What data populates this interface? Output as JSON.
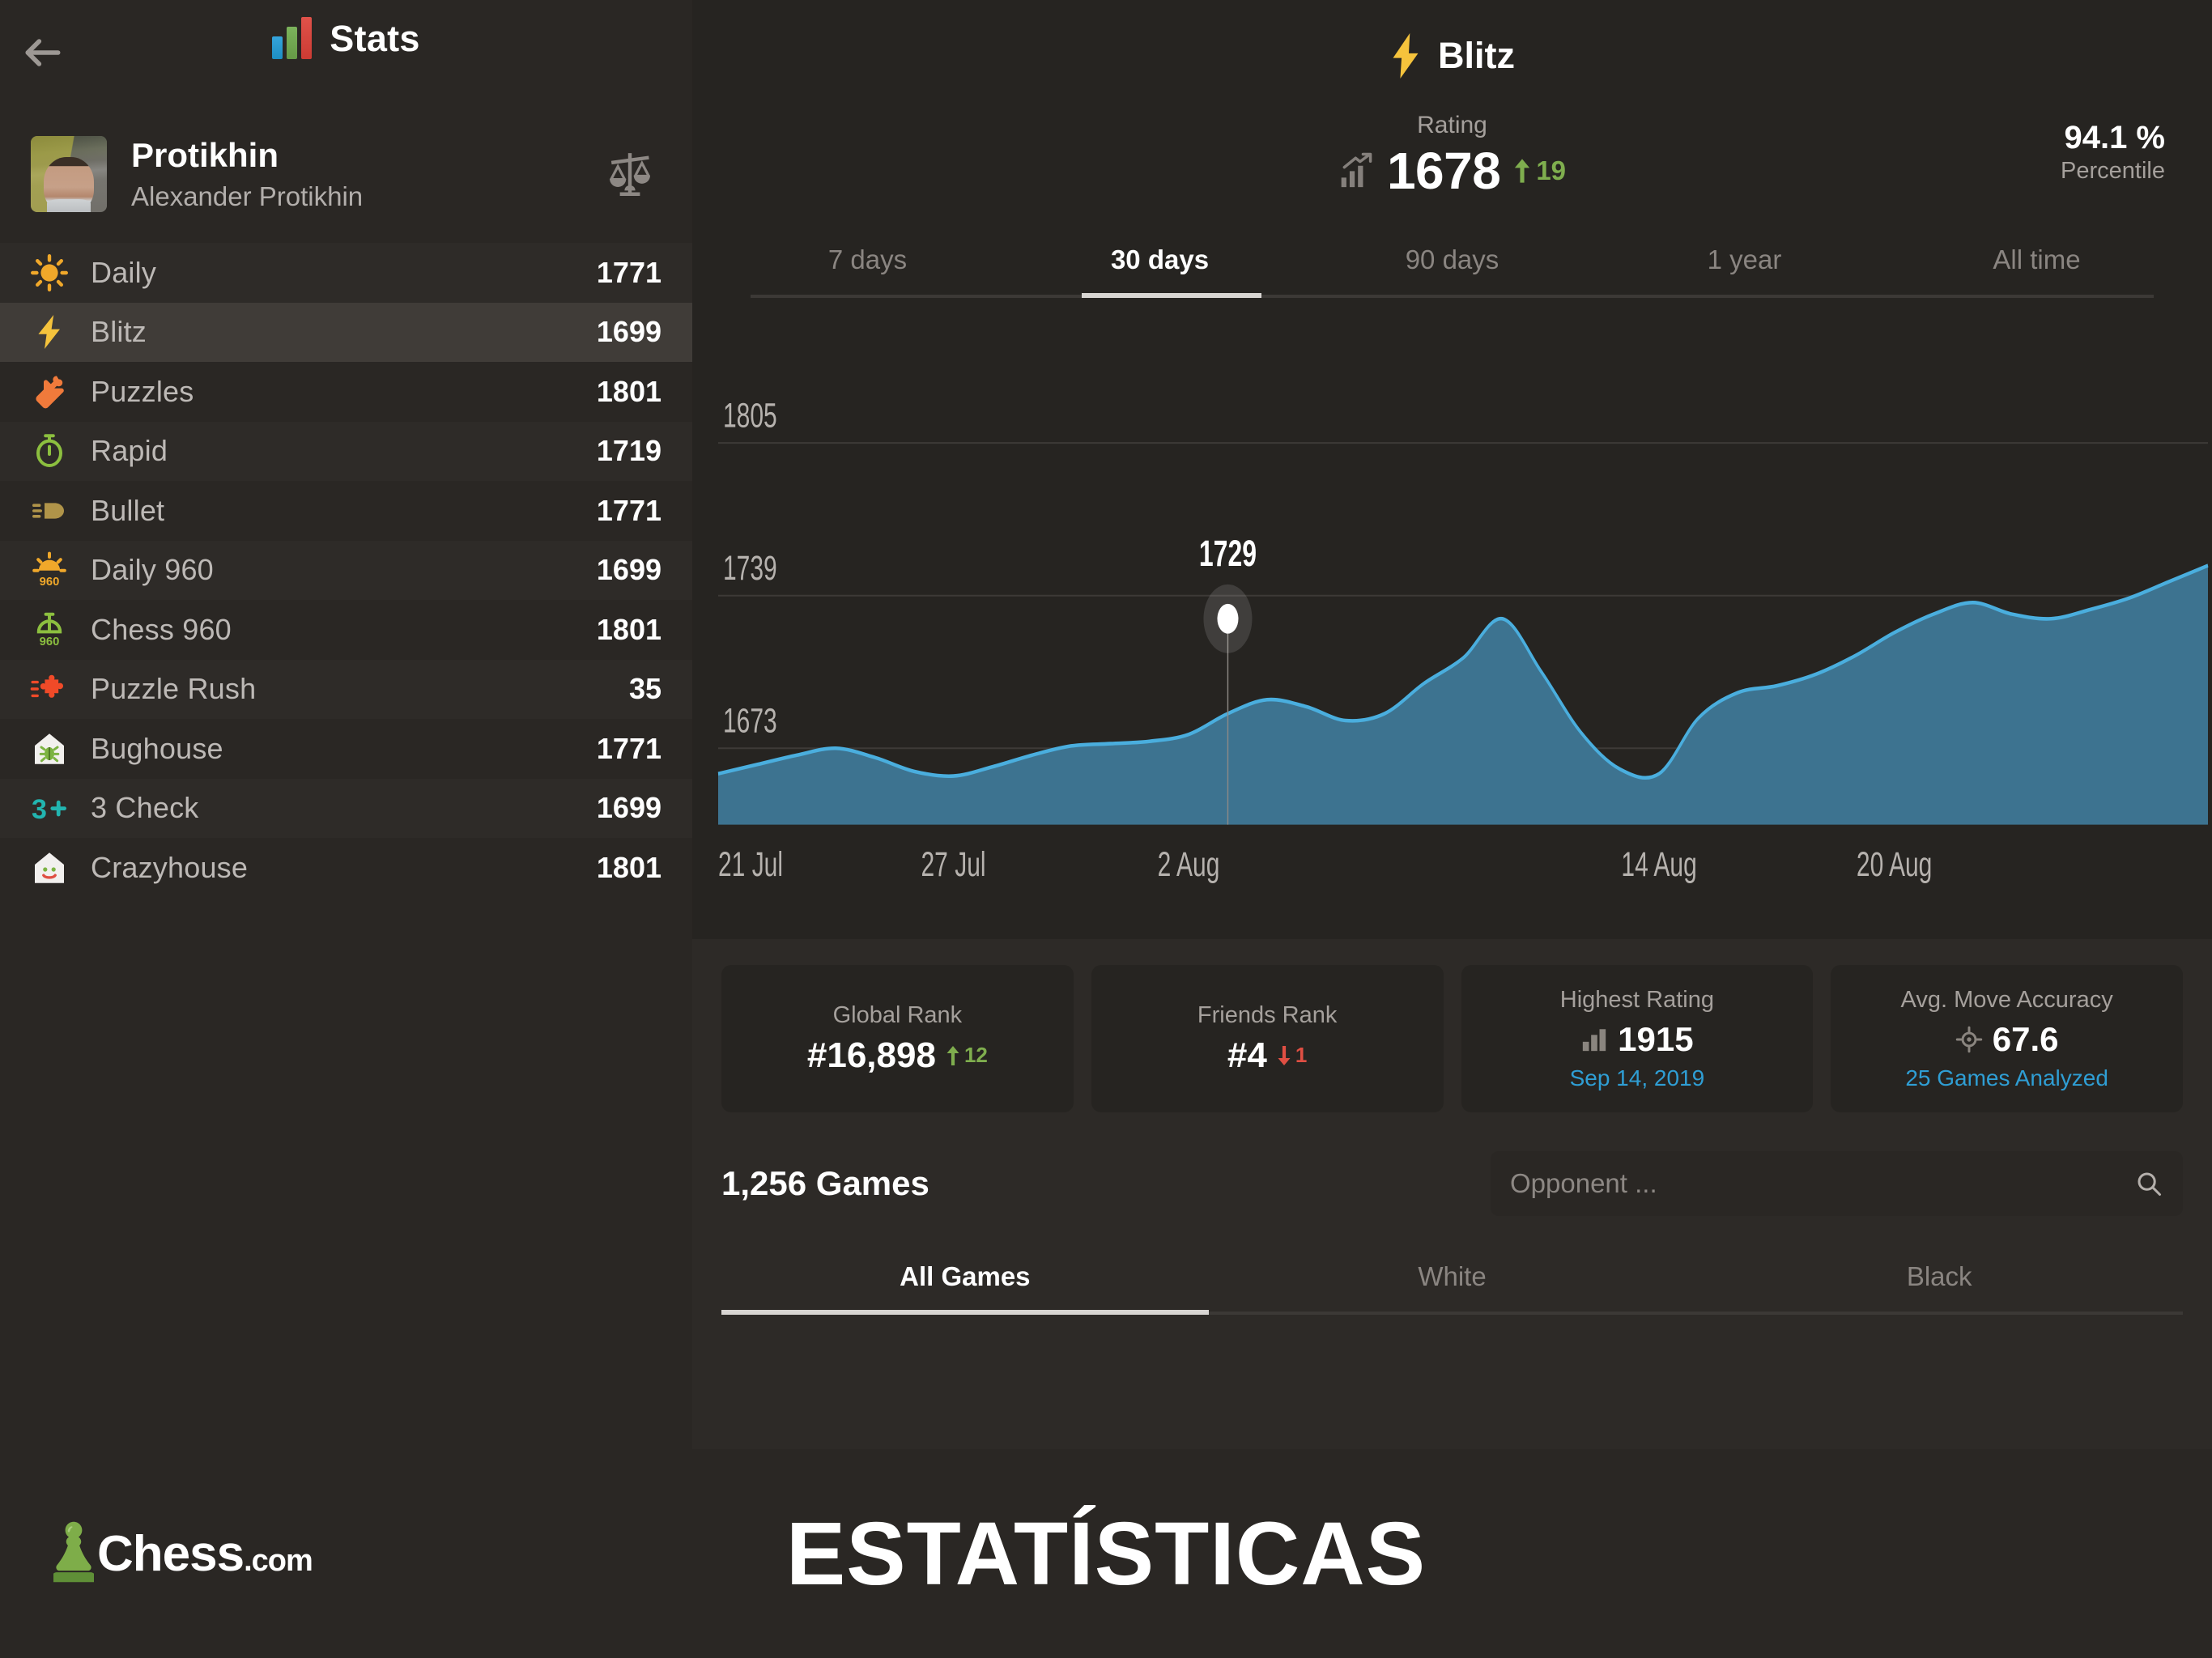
{
  "sidebar": {
    "back_icon": "back-arrow-icon",
    "title": "Stats",
    "profile": {
      "username": "Protikhin",
      "real_name": "Alexander Protikhin",
      "flag": "ukraine-flag",
      "compare_icon": "balance-scales-icon"
    },
    "items": [
      {
        "label": "Daily",
        "value": "1771",
        "icon": "sun-icon"
      },
      {
        "label": "Blitz",
        "value": "1699",
        "icon": "lightning-bolt-icon"
      },
      {
        "label": "Puzzles",
        "value": "1801",
        "icon": "puzzle-piece-icon"
      },
      {
        "label": "Rapid",
        "value": "1719",
        "icon": "stopwatch-icon"
      },
      {
        "label": "Bullet",
        "value": "1771",
        "icon": "bullet-icon"
      },
      {
        "label": "Daily 960",
        "value": "1699",
        "icon": "sun-960-icon"
      },
      {
        "label": "Chess 960",
        "value": "1801",
        "icon": "stopwatch-960-icon"
      },
      {
        "label": "Puzzle Rush",
        "value": "35",
        "icon": "puzzle-rush-icon"
      },
      {
        "label": "Bughouse",
        "value": "1771",
        "icon": "bughouse-icon"
      },
      {
        "label": "3 Check",
        "value": "1699",
        "icon": "three-check-icon"
      },
      {
        "label": "Crazyhouse",
        "value": "1801",
        "icon": "crazyhouse-icon"
      }
    ],
    "active_index": 1
  },
  "main": {
    "header": {
      "title": "Blitz",
      "icon": "lightning-bolt-icon"
    },
    "rating": {
      "label": "Rating",
      "value": "1678",
      "delta": "19",
      "delta_direction": "up",
      "icon": "rating-chart-icon"
    },
    "percentile": {
      "value": "94.1 %",
      "label": "Percentile"
    },
    "range_tabs": [
      {
        "label": "7 days"
      },
      {
        "label": "30 days"
      },
      {
        "label": "90 days"
      },
      {
        "label": "1 year"
      },
      {
        "label": "All time"
      }
    ],
    "range_active_index": 1,
    "cards": [
      {
        "title": "Global Rank",
        "value": "#16,898",
        "change": "12",
        "change_direction": "up",
        "sub": "",
        "icon": ""
      },
      {
        "title": "Friends Rank",
        "value": "#4",
        "change": "1",
        "change_direction": "down",
        "sub": "",
        "icon": ""
      },
      {
        "title": "Highest Rating",
        "value": "1915",
        "change": "",
        "change_direction": "",
        "sub": "Sep 14, 2019",
        "icon": "bar-chart-icon"
      },
      {
        "title": "Avg. Move Accuracy",
        "value": "67.6",
        "change": "",
        "change_direction": "",
        "sub": "25 Games Analyzed",
        "icon": "target-icon"
      }
    ],
    "games": {
      "count_label": "1,256 Games",
      "search_placeholder": "Opponent ...",
      "search_value": "",
      "search_icon": "search-icon",
      "tabs": [
        {
          "label": "All Games"
        },
        {
          "label": "White"
        },
        {
          "label": "Black"
        }
      ],
      "tabs_active_index": 0
    }
  },
  "footer": {
    "brand": "Chess",
    "brand_suffix": ".com",
    "title": "ESTATÍSTICAS",
    "logo_icon": "chess-pawn-logo"
  },
  "colors": {
    "accent_blue": "#4aaede",
    "area_fill": "#3d7390",
    "positive": "#7fae4e",
    "negative": "#e04f43",
    "link": "#2f9ed4",
    "bg": "#262421",
    "panel": "#2a2724",
    "lower_panel": "#2d2a27"
  },
  "chart_data": {
    "type": "area",
    "title": "",
    "xlabel": "",
    "ylabel": "Rating",
    "ylim": [
      1640,
      1838
    ],
    "grid": true,
    "ytick_labels": [
      "1805",
      "1739",
      "1673"
    ],
    "ytick_values": [
      1805,
      1739,
      1673
    ],
    "xtick_labels": [
      "21 Jul",
      "27 Jul",
      "2 Aug",
      "14 Aug",
      "20 Aug"
    ],
    "xtick_positions": [
      0,
      6,
      12,
      24,
      30
    ],
    "highlight": {
      "label": "1729",
      "value": 1729,
      "x_index": 13
    },
    "x": [
      0,
      1,
      2,
      3,
      4,
      5,
      6,
      7,
      8,
      9,
      10,
      11,
      12,
      13,
      14,
      15,
      16,
      17,
      18,
      19,
      20,
      21,
      22,
      23,
      24,
      25,
      26,
      27,
      28,
      29,
      30,
      31,
      32,
      33,
      34,
      35
    ],
    "values": [
      1662,
      1666,
      1670,
      1673,
      1669,
      1663,
      1661,
      1665,
      1670,
      1674,
      1675,
      1676,
      1679,
      1688,
      1694,
      1691,
      1685,
      1688,
      1701,
      1712,
      1729,
      1706,
      1680,
      1664,
      1662,
      1686,
      1697,
      1700,
      1705,
      1713,
      1723,
      1731,
      1736,
      1731,
      1729,
      1733,
      1738,
      1745,
      1752
    ]
  }
}
